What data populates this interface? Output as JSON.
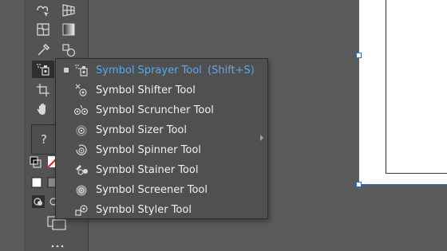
{
  "colors": {
    "canvas": "#5b5b5b",
    "toolbar": "#535353",
    "flyout": "#505050",
    "text": "#f0f0f0",
    "accent": "#5aa8ee",
    "selection": "#2b6fd6"
  },
  "toolbar": {
    "tools": [
      {
        "name": "shape-builder-tool",
        "icon": "shape-builder-icon"
      },
      {
        "name": "perspective-grid-tool",
        "icon": "perspective-grid-icon"
      },
      {
        "name": "mesh-tool",
        "icon": "mesh-icon"
      },
      {
        "name": "gradient-tool",
        "icon": "gradient-icon"
      },
      {
        "name": "eyedropper-tool",
        "icon": "eyedropper-icon"
      },
      {
        "name": "blend-tool",
        "icon": "blend-icon"
      },
      {
        "name": "symbol-sprayer-tool",
        "icon": "symbol-sprayer-icon"
      },
      {
        "name": "column-graph-tool",
        "icon": "column-graph-icon"
      },
      {
        "name": "artboard-tool",
        "icon": "artboard-icon"
      },
      {
        "name": "hand-tool",
        "icon": "hand-icon"
      },
      {
        "name": "fill-stroke",
        "icon": "fill-stroke-icon"
      },
      {
        "name": "draw-mode",
        "icon": "draw-mode-icon"
      },
      {
        "name": "screen-mode",
        "icon": "screen-mode-icon"
      },
      {
        "name": "edit-toolbar",
        "icon": "more-icon"
      }
    ],
    "question_label": "?"
  },
  "flyout": {
    "items": [
      {
        "label": "Symbol Sprayer Tool",
        "shortcut": "(Shift+S)",
        "selected": true,
        "icon": "symbol-sprayer-icon"
      },
      {
        "label": "Symbol Shifter Tool",
        "shortcut": "",
        "selected": false,
        "icon": "symbol-shifter-icon"
      },
      {
        "label": "Symbol Scruncher Tool",
        "shortcut": "",
        "selected": false,
        "icon": "symbol-scruncher-icon"
      },
      {
        "label": "Symbol Sizer Tool",
        "shortcut": "",
        "selected": false,
        "icon": "symbol-sizer-icon"
      },
      {
        "label": "Symbol Spinner Tool",
        "shortcut": "",
        "selected": false,
        "icon": "symbol-spinner-icon"
      },
      {
        "label": "Symbol Stainer Tool",
        "shortcut": "",
        "selected": false,
        "icon": "symbol-stainer-icon"
      },
      {
        "label": "Symbol Screener Tool",
        "shortcut": "",
        "selected": false,
        "icon": "symbol-screener-icon"
      },
      {
        "label": "Symbol Styler Tool",
        "shortcut": "",
        "selected": false,
        "icon": "symbol-styler-icon"
      }
    ]
  }
}
